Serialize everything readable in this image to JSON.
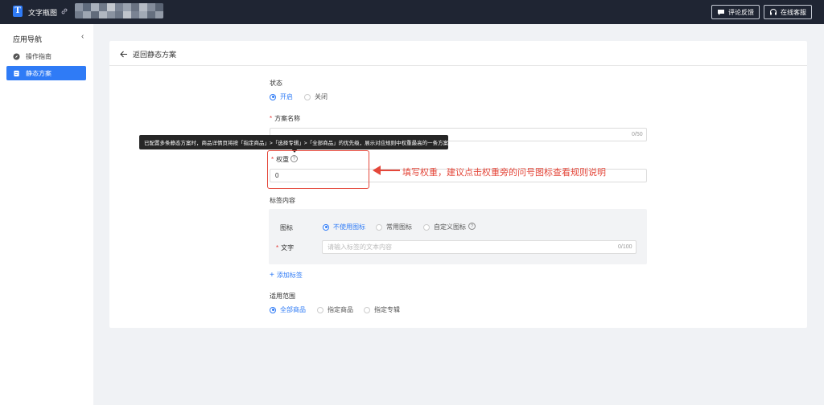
{
  "topbar": {
    "app_name": "文字瓶图",
    "feedback_label": "评论反馈",
    "support_label": "在线客服"
  },
  "sidebar": {
    "title": "应用导航",
    "items": [
      {
        "label": "操作指南",
        "icon": "compass-icon",
        "active": false
      },
      {
        "label": "静态方案",
        "icon": "document-icon",
        "active": true
      }
    ]
  },
  "page": {
    "back_label": "返回静态方案"
  },
  "form": {
    "status": {
      "label": "状态",
      "options": [
        "开启",
        "关闭"
      ],
      "selected": "开启"
    },
    "plan_name": {
      "label": "方案名称",
      "value": "",
      "counter": "0/50"
    },
    "tooltip_text": "已配置多条静态方案时，商品详情页将按「指定商品」>「选择专辑」>「全部商品」的优先级，展示对应规则中权重最高的一条方案",
    "weight": {
      "label": "权重",
      "value": "0"
    },
    "annotation": "填写权重，建议点击权重旁的问号图标查看规则说明",
    "tag_content": {
      "label": "标签内容",
      "icon_label": "图标",
      "icon_options": [
        "不使用图标",
        "常用图标",
        "自定义图标"
      ],
      "icon_selected": "不使用图标",
      "text_label": "文字",
      "text_placeholder": "请输入标签的文本内容",
      "text_counter": "0/100"
    },
    "add_tag_label": "添加标签",
    "scope": {
      "label": "适用范围",
      "options": [
        "全部商品",
        "指定商品",
        "指定专辑"
      ],
      "selected": "全部商品"
    }
  },
  "colors": {
    "accent": "#2f7bf6",
    "topbar": "#1f2533",
    "annotation": "#e4473a"
  }
}
